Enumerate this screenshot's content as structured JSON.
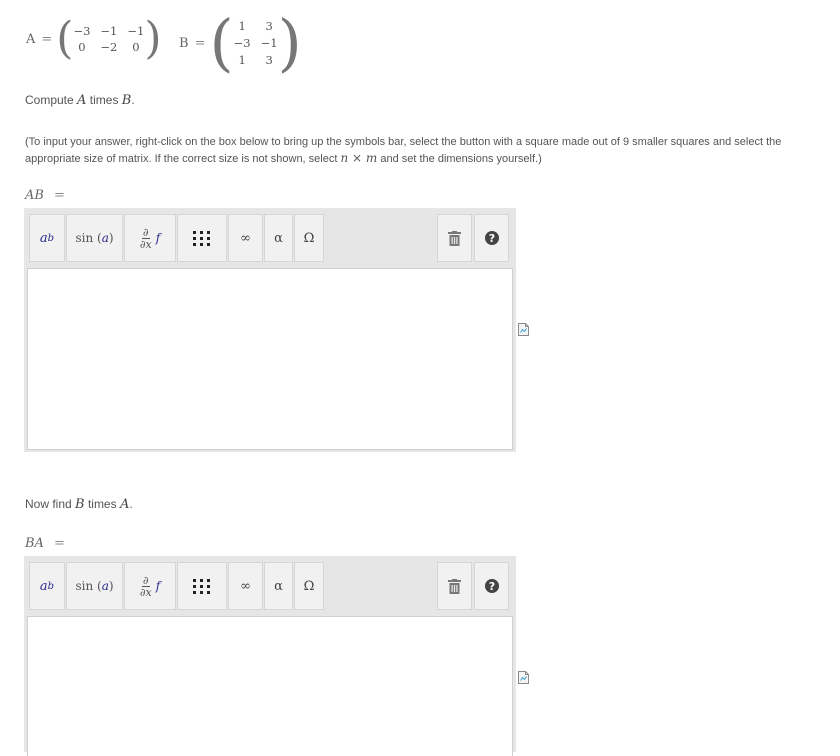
{
  "matrices": [
    {
      "name": "A",
      "rows": [
        [
          "−3",
          "−1",
          "−1"
        ],
        [
          "0",
          "−2",
          "0"
        ]
      ]
    },
    {
      "name": "B",
      "rows": [
        [
          "1",
          "3"
        ],
        [
          "−3",
          "−1"
        ],
        [
          "1",
          "3"
        ]
      ]
    }
  ],
  "equals": "=",
  "question1": {
    "prefix": "Compute",
    "v1": "A",
    "mid": "times",
    "v2": "B",
    "suffix": "."
  },
  "instructions": {
    "part1": "(To input your answer, right-click on the box below to bring up the symbols bar, select the button with a square made out of 9 smaller squares and select the appropriate size of matrix. If the correct size is not shown, select",
    "nxm": "n × m",
    "part2": "and set the dimensions yourself.)"
  },
  "answer1_label": "AB",
  "question2": {
    "prefix": "Now find",
    "v1": "B",
    "mid": "times",
    "v2": "A",
    "suffix": "."
  },
  "answer2_label": "BA",
  "toolbar": {
    "sup": {
      "base": "a",
      "exp": "b"
    },
    "sin": {
      "fn": "sin",
      "arg": "a"
    },
    "deriv": {
      "num": "∂",
      "den": "∂x",
      "f": "f"
    },
    "infinity": "∞",
    "alpha": "α",
    "omega": "Ω",
    "trash_icon": "trash-icon",
    "help_icon": "help-icon",
    "help_glyph": "?"
  },
  "colors": {
    "toolbar_bg": "#e6e6e6",
    "button_bg": "#f1f1f1",
    "variable_blue": "#2a2a8c"
  }
}
